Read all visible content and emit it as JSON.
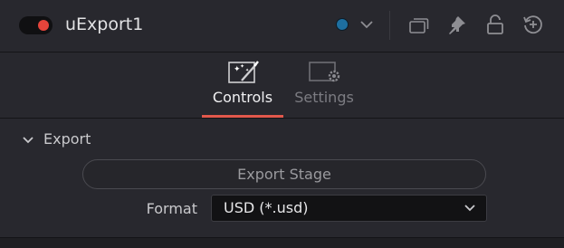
{
  "header": {
    "title": "uExport1",
    "toggle_state": "on",
    "color_swatch": "#1e6fa0",
    "icons": [
      "color-dropdown-chevron-icon",
      "windows-icon",
      "pin-icon",
      "lock-icon",
      "reset-icon"
    ]
  },
  "tabs": [
    {
      "label": "Controls",
      "icon": "magic-wand-icon",
      "active": true
    },
    {
      "label": "Settings",
      "icon": "gear-screen-icon",
      "active": false
    }
  ],
  "section": {
    "title": "Export",
    "expanded": true,
    "export_button_label": "Export Stage",
    "format_label": "Format",
    "format_value": "USD (*.usd)"
  },
  "colors": {
    "accent": "#e2584c",
    "toggle_dot": "#e5443b",
    "panel": "#28282e",
    "background": "#1d1d20"
  }
}
